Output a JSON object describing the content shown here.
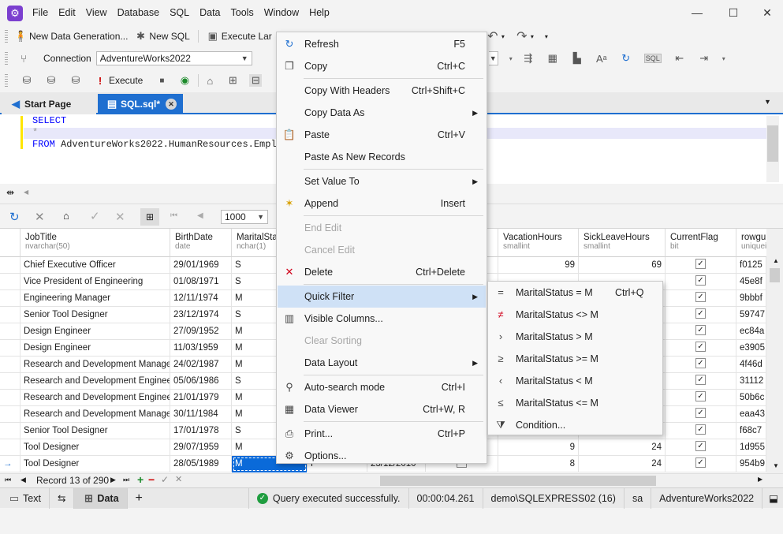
{
  "menubar": [
    "File",
    "Edit",
    "View",
    "Database",
    "SQL",
    "Data",
    "Tools",
    "Window",
    "Help"
  ],
  "toolbar1": {
    "new_data_gen": "New Data Generation...",
    "new_sql": "New SQL",
    "execute_large": "Execute Lar"
  },
  "toolbar2": {
    "connection_label": "Connection",
    "connection_value": "AdventureWorks2022"
  },
  "toolbar3": {
    "execute": "Execute"
  },
  "tabs": {
    "start_page": "Start Page",
    "sql_tab": "SQL.sql*"
  },
  "sql": {
    "line1": "SELECT",
    "line2": "*",
    "line3_kw": "FROM",
    "line3_rest": " AdventureWorks2022.HumanResources.Emplo"
  },
  "grid_toolbar": {
    "page_size": "1000"
  },
  "columns": [
    {
      "name": "JobTitle",
      "type": "nvarchar(50)"
    },
    {
      "name": "BirthDate",
      "type": "date"
    },
    {
      "name": "MaritalSta",
      "type": "nchar(1)"
    },
    {
      "name": "",
      "type": ""
    },
    {
      "name": "",
      "type": ""
    },
    {
      "name": "VacationHours",
      "type": "smallint"
    },
    {
      "name": "SickLeaveHours",
      "type": "smallint"
    },
    {
      "name": "CurrentFlag",
      "type": "bit"
    },
    {
      "name": "rowguid",
      "type": "uniqueider"
    }
  ],
  "rows": [
    {
      "job": "Chief Executive Officer",
      "birth": "29/01/1969",
      "ms": "S",
      "vac": "99",
      "sick": "69",
      "guid": "f0125"
    },
    {
      "job": "Vice President of Engineering",
      "birth": "01/08/1971",
      "ms": "S",
      "vac": "",
      "sick": "",
      "guid": "45e8f"
    },
    {
      "job": "Engineering Manager",
      "birth": "12/11/1974",
      "ms": "M",
      "vac": "",
      "sick": "",
      "guid": "9bbbf"
    },
    {
      "job": "Senior Tool Designer",
      "birth": "23/12/1974",
      "ms": "S",
      "vac": "",
      "sick": "",
      "guid": "59747"
    },
    {
      "job": "Design Engineer",
      "birth": "27/09/1952",
      "ms": "M",
      "vac": "",
      "sick": "",
      "guid": "ec84a"
    },
    {
      "job": "Design Engineer",
      "birth": "11/03/1959",
      "ms": "M",
      "vac": "",
      "sick": "",
      "guid": "e3905"
    },
    {
      "job": "Research and Development Manager",
      "birth": "24/02/1987",
      "ms": "M",
      "vac": "",
      "sick": "",
      "guid": "4f46d"
    },
    {
      "job": "Research and Development Engineer",
      "birth": "05/06/1986",
      "ms": "S",
      "vac": "",
      "sick": "",
      "guid": "31112"
    },
    {
      "job": "Research and Development Engineer",
      "birth": "21/01/1979",
      "ms": "M",
      "vac": "",
      "sick": "",
      "guid": "50b6c"
    },
    {
      "job": "Research and Development Manager",
      "birth": "30/11/1984",
      "ms": "M",
      "vac": "",
      "sick": "",
      "guid": "eaa43"
    },
    {
      "job": "Senior Tool Designer",
      "birth": "17/01/1978",
      "ms": "S",
      "vac": "",
      "sick": "",
      "guid": "f68c7"
    },
    {
      "job": "Tool Designer",
      "birth": "29/07/1959",
      "ms": "M",
      "vac": "9",
      "sick": "24",
      "guid": "1d955"
    },
    {
      "job": "Tool Designer",
      "birth": "28/05/1989",
      "ms": "M",
      "vac": "8",
      "sick": "24",
      "guid": "954b9",
      "extra_gender": "F",
      "extra_date": "23/12/2010"
    }
  ],
  "record_nav": "Record 13 of 290",
  "context_menu": [
    {
      "label": "Refresh",
      "shortcut": "F5",
      "icon": "refresh-icon"
    },
    {
      "label": "Copy",
      "shortcut": "Ctrl+C",
      "icon": "copy-icon"
    },
    {
      "label": "Copy With Headers",
      "shortcut": "Ctrl+Shift+C"
    },
    {
      "label": "Copy Data As",
      "submenu": true
    },
    {
      "label": "Paste",
      "shortcut": "Ctrl+V",
      "icon": "paste-icon"
    },
    {
      "label": "Paste As New Records"
    },
    {
      "label": "Set Value To",
      "submenu": true
    },
    {
      "label": "Append",
      "shortcut": "Insert",
      "icon": "append-icon"
    },
    {
      "label": "End Edit",
      "disabled": true
    },
    {
      "label": "Cancel Edit",
      "disabled": true
    },
    {
      "label": "Delete",
      "shortcut": "Ctrl+Delete",
      "icon": "delete-icon"
    },
    {
      "label": "Quick Filter",
      "submenu": true,
      "highlighted": true
    },
    {
      "label": "Visible Columns...",
      "icon": "columns-icon"
    },
    {
      "label": "Clear Sorting",
      "disabled": true
    },
    {
      "label": "Data Layout",
      "submenu": true
    },
    {
      "label": "Auto-search mode",
      "shortcut": "Ctrl+I",
      "icon": "search-icon"
    },
    {
      "label": "Data Viewer",
      "shortcut": "Ctrl+W, R",
      "icon": "data-viewer-icon"
    },
    {
      "label": "Print...",
      "shortcut": "Ctrl+P",
      "icon": "print-icon"
    },
    {
      "label": "Options...",
      "icon": "gear-icon"
    }
  ],
  "quick_filter_menu": [
    {
      "label": "MaritalStatus = M",
      "shortcut": "Ctrl+Q",
      "icon": "equals-icon"
    },
    {
      "label": "MaritalStatus <> M",
      "icon": "not-equals-icon"
    },
    {
      "label": "MaritalStatus > M",
      "icon": "greater-icon"
    },
    {
      "label": "MaritalStatus >= M",
      "icon": "greater-equal-icon"
    },
    {
      "label": "MaritalStatus < M",
      "icon": "less-icon"
    },
    {
      "label": "MaritalStatus <= M",
      "icon": "less-equal-icon"
    },
    {
      "label": "Condition...",
      "icon": "filter-icon"
    }
  ],
  "bottombar": {
    "text_tab": "Text",
    "data_tab": "Data",
    "status": "Query executed successfully.",
    "elapsed": "00:00:04.261",
    "server": "demo\\SQLEXPRESS02 (16)",
    "user": "sa",
    "database": "AdventureWorks2022"
  }
}
